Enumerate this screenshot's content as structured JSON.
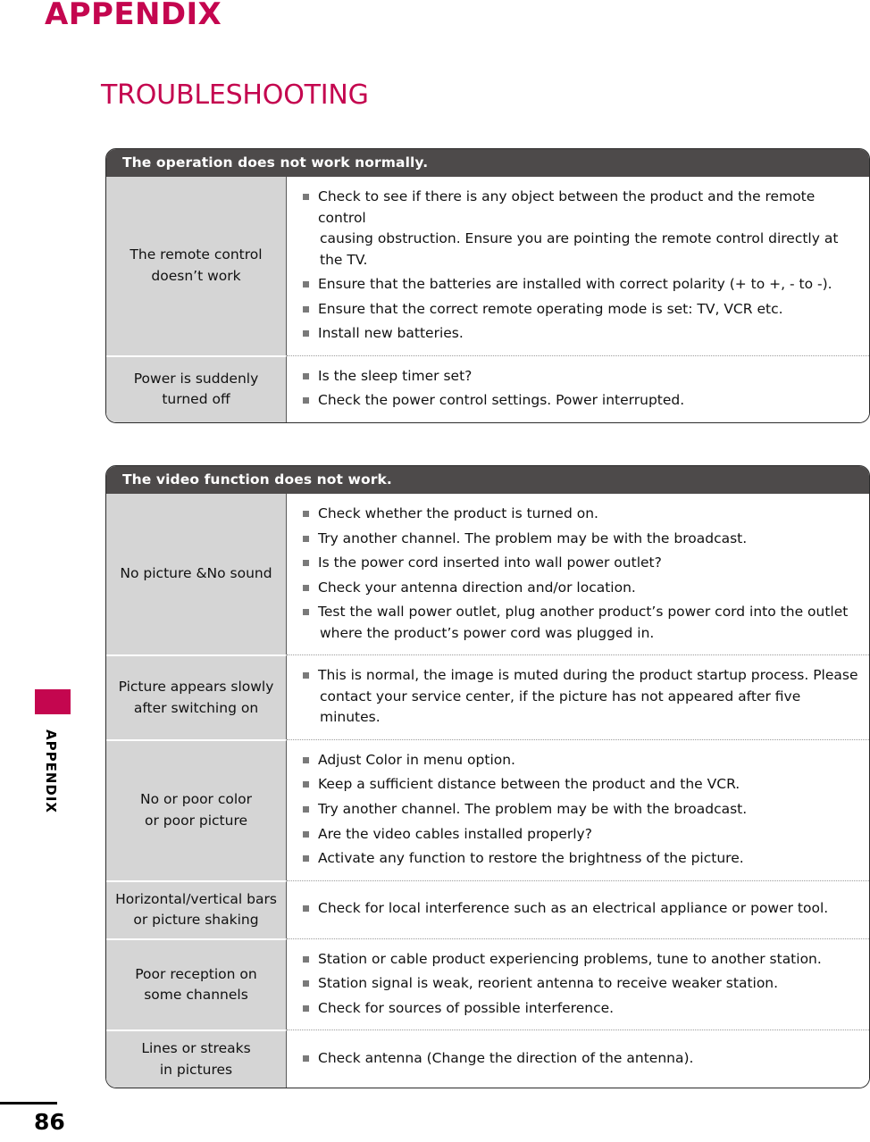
{
  "header": {
    "appendix_title": "APPENDIX",
    "section_title": "TROUBLESHOOTING"
  },
  "side_tab": {
    "label": "APPENDIX"
  },
  "footer": {
    "page_number": "86"
  },
  "colors": {
    "accent": "#c4064f",
    "table_header_bg": "#4d4a4a",
    "symptom_cell_bg": "#d5d5d5",
    "bullet": "#7a7a7a"
  },
  "tables": [
    {
      "id": "table-1",
      "header": "The operation does not work normally.",
      "rows": [
        {
          "symptom_lines": [
            "The remote control",
            "doesn’t work"
          ],
          "checks": [
            {
              "text": "Check to see if there is any object between the product and the remote control",
              "cont": "causing obstruction. Ensure you are pointing the remote control directly at the TV."
            },
            {
              "text": "Ensure that the batteries are installed with correct polarity (+ to +, - to -).",
              "cont": ""
            },
            {
              "text": "Ensure that the correct remote operating mode is set: TV, VCR etc.",
              "cont": ""
            },
            {
              "text": "Install new batteries.",
              "cont": ""
            }
          ]
        },
        {
          "symptom_lines": [
            "Power is suddenly",
            "turned off"
          ],
          "checks": [
            {
              "text": "Is the sleep timer set?",
              "cont": ""
            },
            {
              "text": "Check the power control settings. Power interrupted.",
              "cont": ""
            }
          ]
        }
      ]
    },
    {
      "id": "table-2",
      "header": "The video function does not work.",
      "rows": [
        {
          "symptom_lines": [
            "No picture &No sound"
          ],
          "checks": [
            {
              "text": "Check whether the product is turned on.",
              "cont": ""
            },
            {
              "text": "Try another channel. The problem may be with the broadcast.",
              "cont": ""
            },
            {
              "text": "Is the power cord inserted into wall power outlet?",
              "cont": ""
            },
            {
              "text": "Check your antenna direction and/or location.",
              "cont": ""
            },
            {
              "text": "Test the wall power outlet, plug another product’s power cord into the outlet",
              "cont": "where the product’s power cord was plugged in."
            }
          ]
        },
        {
          "symptom_lines": [
            "Picture appears slowly",
            "after switching on"
          ],
          "checks": [
            {
              "text": "This is normal, the image is muted during the product startup process. Please",
              "cont": "contact your service center, if the picture has not appeared after five minutes."
            }
          ]
        },
        {
          "symptom_lines": [
            "No or poor color",
            "or poor picture"
          ],
          "checks": [
            {
              "text": "Adjust Color in menu option.",
              "cont": ""
            },
            {
              "text": "Keep a sufficient distance between the product and the VCR.",
              "cont": ""
            },
            {
              "text": "Try another channel. The problem may be with the broadcast.",
              "cont": ""
            },
            {
              "text": "Are the video cables installed properly?",
              "cont": ""
            },
            {
              "text": "Activate any function to restore the brightness of the picture.",
              "cont": ""
            }
          ]
        },
        {
          "symptom_lines": [
            "Horizontal/vertical bars",
            "or picture shaking"
          ],
          "checks": [
            {
              "text": "Check for local interference such as an electrical appliance or power tool.",
              "cont": ""
            }
          ]
        },
        {
          "symptom_lines": [
            "Poor reception on",
            "some channels"
          ],
          "checks": [
            {
              "text": "Station or cable product experiencing problems, tune to another station.",
              "cont": ""
            },
            {
              "text": "Station signal is weak, reorient antenna to receive weaker station.",
              "cont": ""
            },
            {
              "text": "Check for sources of possible interference.",
              "cont": ""
            }
          ]
        },
        {
          "symptom_lines": [
            "Lines or streaks",
            "in pictures"
          ],
          "checks": [
            {
              "text": "Check antenna (Change the direction of the antenna).",
              "cont": ""
            }
          ]
        }
      ]
    }
  ]
}
